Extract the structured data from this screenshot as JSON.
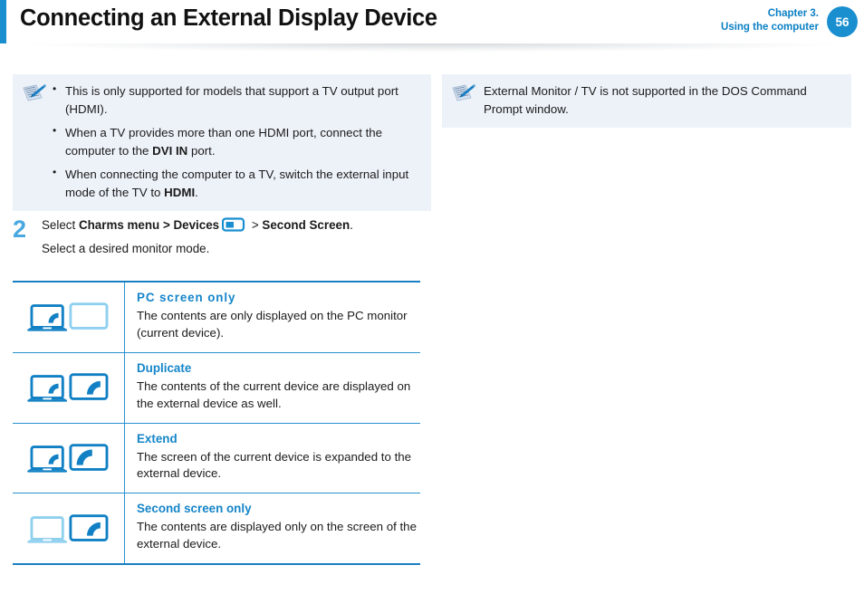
{
  "header": {
    "title": "Connecting an External Display Device",
    "chapter_line1": "Chapter 3.",
    "chapter_line2": "Using the computer",
    "page_number": "56",
    "accent_color": "#1a8fd0"
  },
  "notes": {
    "left": {
      "icon": "note-pencil-icon",
      "bullets": [
        "This is only supported for models that support a TV output port (HDMI).",
        "When a TV provides more than one HDMI port, connect the computer to the DVI IN port.",
        "When connecting the computer to a TV, switch the external input mode of the TV to HDMI."
      ],
      "bullet_bold_terms": [
        "",
        "DVI IN",
        "HDMI"
      ]
    },
    "right": {
      "icon": "note-pencil-icon",
      "text": "External Monitor / TV is not supported in the DOS Command Prompt window."
    }
  },
  "step": {
    "number": "2",
    "line1_prefix": "Select ",
    "line1_bold1": "Charms menu > Devices",
    "line1_icon": "devices-icon",
    "line1_mid": " > ",
    "line1_bold2": "Second Screen",
    "line1_suffix": ".",
    "line2": "Select a desired monitor mode."
  },
  "mode_table": {
    "rows": [
      {
        "icon": "pc-screen-only-icon",
        "title": "PC screen only",
        "desc": "The contents are only displayed on the PC monitor (current device)."
      },
      {
        "icon": "duplicate-icon",
        "title": "Duplicate",
        "desc": "The contents of the current device are displayed on the external device as well."
      },
      {
        "icon": "extend-icon",
        "title": "Extend",
        "desc": "The screen of the current device is expanded to the external device."
      },
      {
        "icon": "second-screen-only-icon",
        "title": "Second screen only",
        "desc": "The contents are displayed only on the screen of the external device."
      }
    ]
  },
  "colors": {
    "brand_blue": "#1a8fd0",
    "deep_blue": "#1180c4",
    "light_blue": "#8fd0ef",
    "note_bg": "#edf2f9",
    "step_num": "#4aa8e0"
  }
}
